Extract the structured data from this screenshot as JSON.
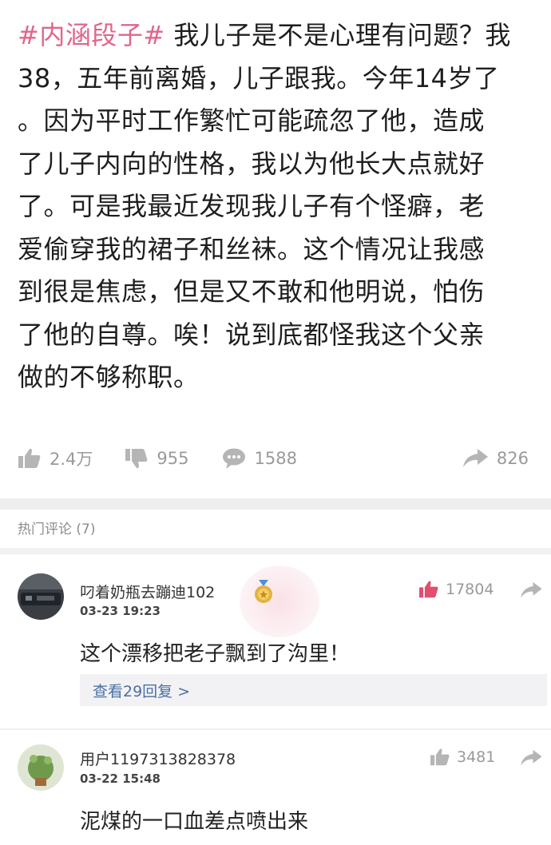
{
  "post": {
    "tag": "#内涵段子#",
    "lines": [
      " 我儿子是不是心理有问题？我",
      "38，五年前离婚，儿子跟我。今年14岁了",
      "。因为平时工作繁忙可能疏忽了他，造成",
      "了儿子内向的性格，我以为他长大点就好",
      "了。可是我最近发现我儿子有个怪癖，老",
      "爱偷穿我的裙子和丝袜。这个情况让我感",
      "到很是焦虑，但是又不敢和他明说，怕伤",
      "了他的自尊。唉！说到底都怪我这个父亲",
      "做的不够称职。"
    ],
    "likes": "2.4万",
    "dislikes": "955",
    "comments": "1588",
    "shares": "826"
  },
  "hot_comments": {
    "header": "热门评论 (7)"
  },
  "comments": [
    {
      "username": "叼着奶瓶去蹦迪102",
      "time": "03-23 19:23",
      "text": "这个漂移把老子飘到了沟里！",
      "likes": "17804",
      "replies": "查看29回复 >"
    },
    {
      "username": "用户1197313828378",
      "time": "03-22 15:48",
      "text": "泥煤的一口血差点喷出来",
      "likes": "3481"
    }
  ],
  "colors": {
    "tag": "#e0668a",
    "like_active": "#e0506e",
    "reply_link": "#4a6fa5"
  },
  "icons": [
    "thumb-up-icon",
    "thumb-down-icon",
    "comment-icon",
    "share-icon",
    "medal-icon"
  ]
}
